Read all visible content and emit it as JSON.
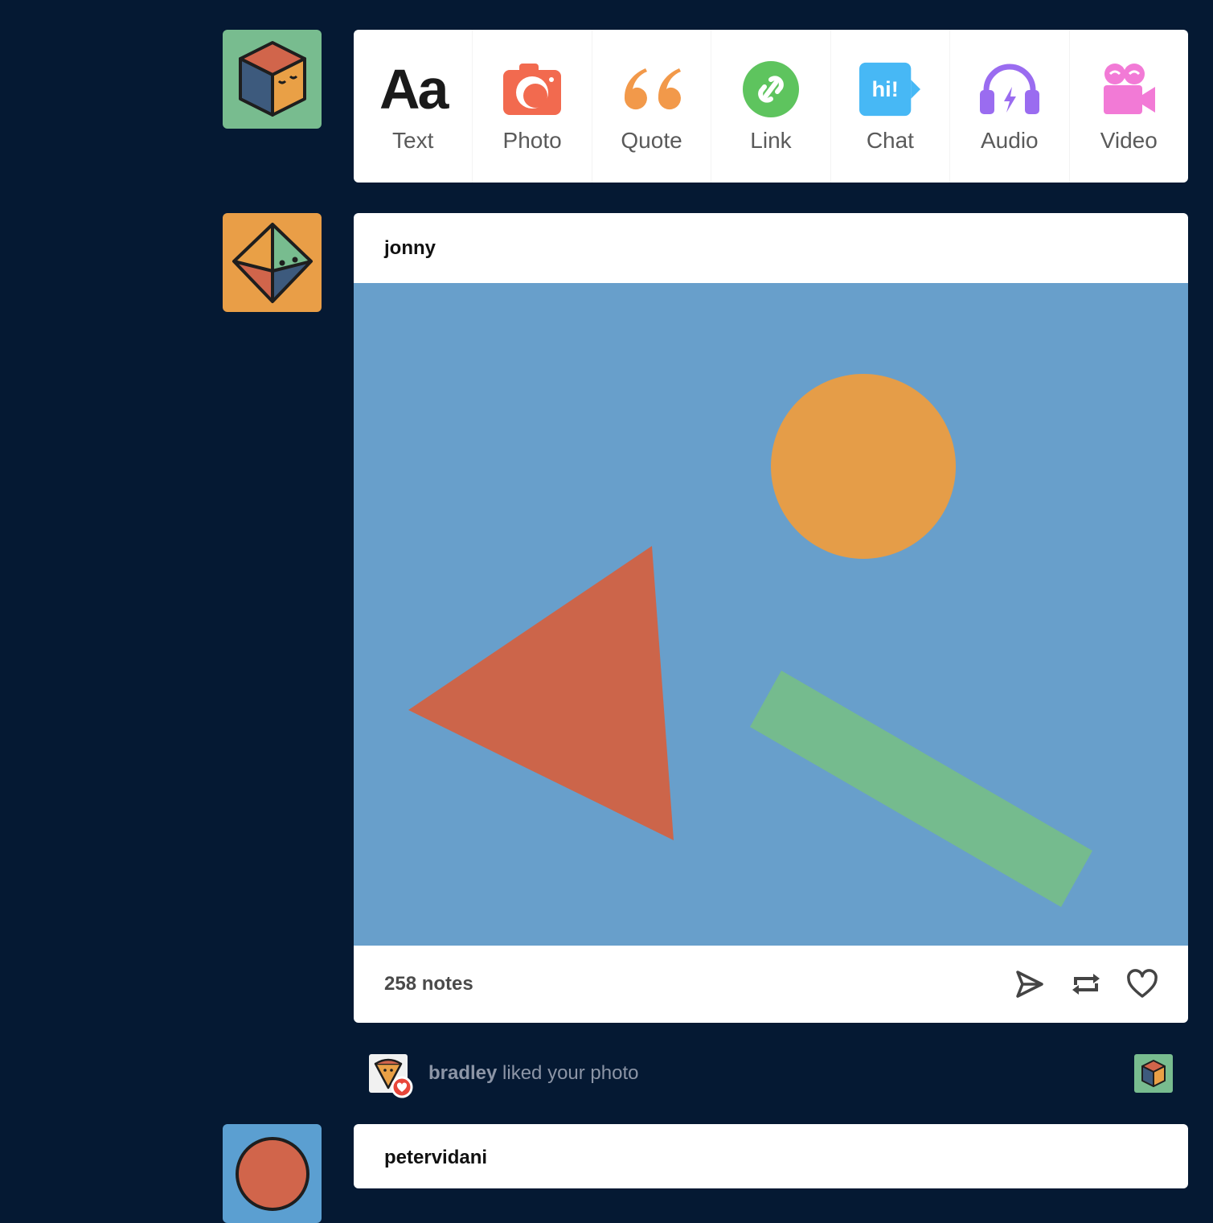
{
  "composer": {
    "post_types": [
      {
        "label": "Text",
        "icon": "text-icon",
        "glyph": "Aa"
      },
      {
        "label": "Photo",
        "icon": "camera-icon",
        "color": "#f26a4f"
      },
      {
        "label": "Quote",
        "icon": "quote-icon",
        "color": "#f2994a"
      },
      {
        "label": "Link",
        "icon": "link-icon",
        "color": "#5ec45e"
      },
      {
        "label": "Chat",
        "icon": "chat-icon",
        "color": "#47b8f5",
        "glyph": "hi!"
      },
      {
        "label": "Audio",
        "icon": "headphones-icon",
        "color": "#9a6cf0"
      },
      {
        "label": "Video",
        "icon": "video-camera-icon",
        "color": "#f27ad6"
      }
    ]
  },
  "post": {
    "author": "jonny",
    "notes": "258 notes",
    "image_colors": {
      "background": "#689fcb",
      "circle": "#e59d48",
      "triangle": "#cc654a",
      "bar": "#75bb8e"
    }
  },
  "activity": {
    "user": "bradley",
    "action": "liked your photo"
  },
  "next_post": {
    "author": "petervidani"
  },
  "colors": {
    "page_background": "#051933",
    "avatar_cube_bg": "#78bc8f",
    "avatar_diamond_bg": "#e99e47",
    "avatar_next_bg": "#5b9fd1"
  }
}
